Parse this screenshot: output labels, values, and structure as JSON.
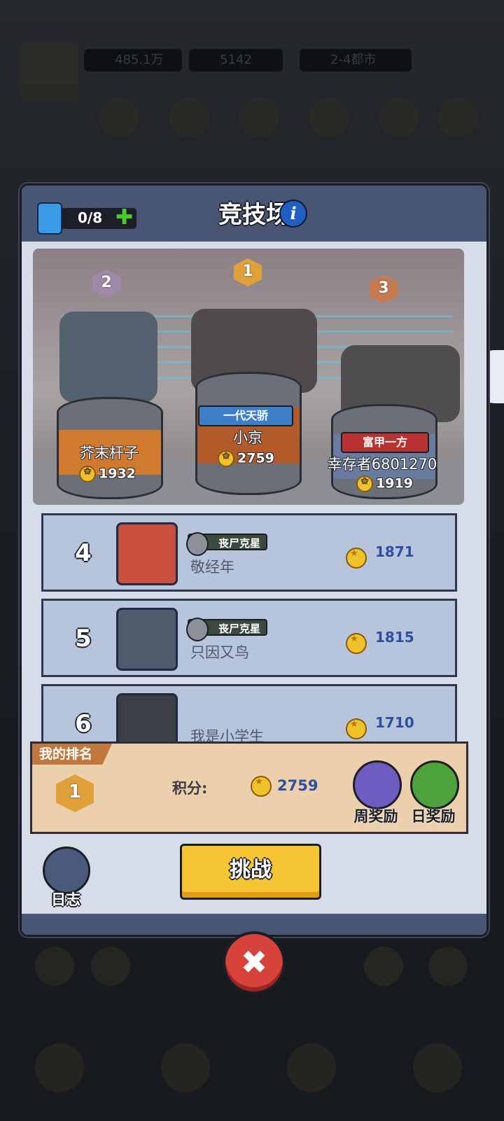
{
  "background": {
    "currency1": "485.1万",
    "currency2": "5142",
    "currency3": "2-4都市"
  },
  "modal": {
    "title": "竞技场",
    "tickets": "0/8"
  },
  "podium": [
    {
      "rank": "2",
      "name": "芥末杆子",
      "score": "1932",
      "title": ""
    },
    {
      "rank": "1",
      "name": "小京",
      "score": "2759",
      "title": "一代天骄"
    },
    {
      "rank": "3",
      "name": "幸存者6801270",
      "score": "1919",
      "title": "富甲一方"
    }
  ],
  "ranking": [
    {
      "rank": "4",
      "name": "敬经年",
      "badge": "丧尸克星",
      "score": "1871"
    },
    {
      "rank": "5",
      "name": "只因又鸟",
      "badge": "丧尸克星",
      "score": "1815"
    },
    {
      "rank": "6",
      "name": "我是小学生",
      "badge": "",
      "score": "1710"
    }
  ],
  "my_rank": {
    "tag": "我的排名",
    "rank": "1",
    "score_label": "积分:",
    "score": "2759",
    "weekly_reward": "周奖励",
    "daily_reward": "日奖励"
  },
  "buttons": {
    "log": "日志",
    "challenge": "挑战"
  },
  "colors": {
    "header": "#485573",
    "challenge": "#f5c534",
    "close": "#d7433b",
    "score": "#2f4ea0"
  }
}
